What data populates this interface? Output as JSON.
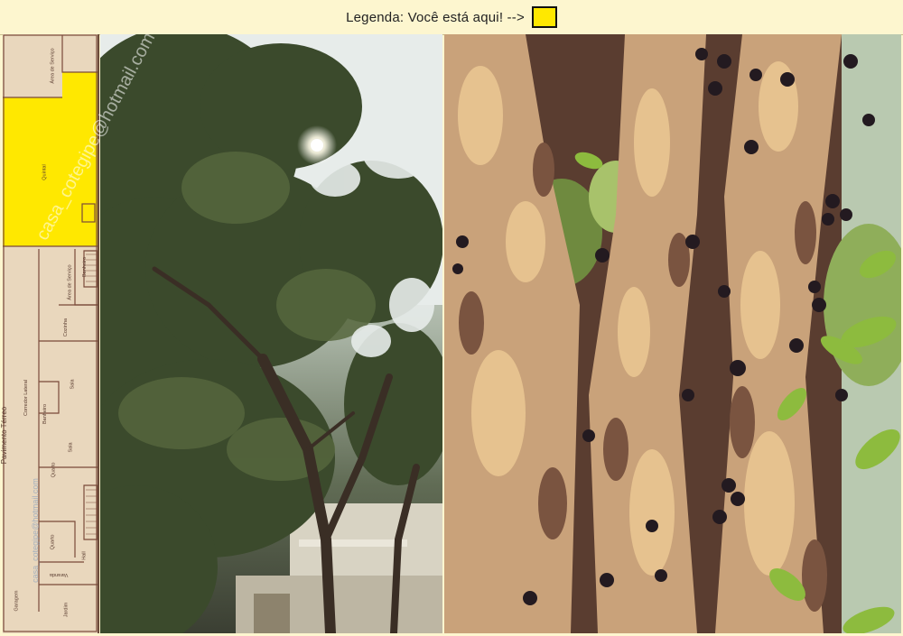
{
  "legend": {
    "text": "Legenda:  Você está aqui! -->",
    "swatch_color": "#ffe800"
  },
  "floorplan": {
    "highlight_color": "#ffe800",
    "labels": {
      "area_servico_top": "Área de Serviço",
      "quintal": "Quintal",
      "banheiro_top": "Banheiro",
      "area_servico": "Área de Serviço",
      "cozinha": "Cozinha",
      "pavimento": "Pavimento Térreo",
      "corredor": "Corredor Lateral",
      "sala1": "Sala",
      "banheiro": "Banheiro",
      "sala2": "Sala",
      "quarto1": "Quarto",
      "quarto2": "Quarto",
      "hall": "Hall",
      "varanda": "Varanda",
      "garagem": "Garagem",
      "jardim": "Jardim"
    },
    "watermark_email": "casa_cotegipe@hotmail.com"
  },
  "watermark": "casa_cotegipe@hotmail.com",
  "icons": {
    "sun": "sun-icon",
    "fruit": "jabuticaba-fruit-icon"
  }
}
